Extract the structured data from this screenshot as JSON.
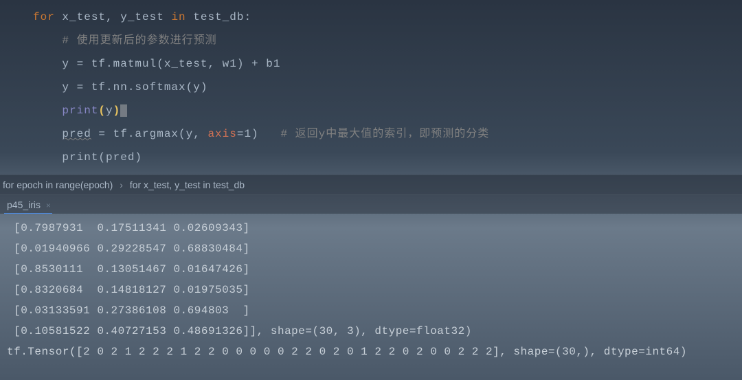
{
  "code": {
    "line1_for": "for",
    "line1_vars": " x_test, y_test ",
    "line1_in": "in",
    "line1_iter": " test_db:",
    "line2_comment": "# 使用更新后的参数进行预测",
    "line3": "y = tf.matmul(x_test, w1) + b1",
    "line4": "y = tf.nn.softmax(y)",
    "line5_print": "print",
    "line5_arg": "y",
    "line6_pred": "pred",
    "line6_eq": " = tf.argmax(y, ",
    "line6_axis": "axis",
    "line6_val": "=1)   ",
    "line6_comment": "# 返回y中最大值的索引，即预测的分类",
    "line7": "print(pred)"
  },
  "breadcrumb": {
    "item1": "for epoch in range(epoch)",
    "item2": "for x_test, y_test in test_db"
  },
  "tab": {
    "name": "p45_iris"
  },
  "output": {
    "l1": " [0.7987931  0.17511341 0.02609343]",
    "l2": " [0.01940966 0.29228547 0.68830484]",
    "l3": " [0.8530111  0.13051467 0.01647426]",
    "l4": " [0.8320684  0.14818127 0.01975035]",
    "l5": " [0.03133591 0.27386108 0.694803  ]",
    "l6": " [0.10581522 0.40727153 0.48691326]], shape=(30, 3), dtype=float32)",
    "l7": "tf.Tensor([2 0 2 1 2 2 2 1 2 2 0 0 0 0 0 2 2 0 2 0 1 2 2 0 2 0 0 2 2 2], shape=(30,), dtype=int64)"
  }
}
